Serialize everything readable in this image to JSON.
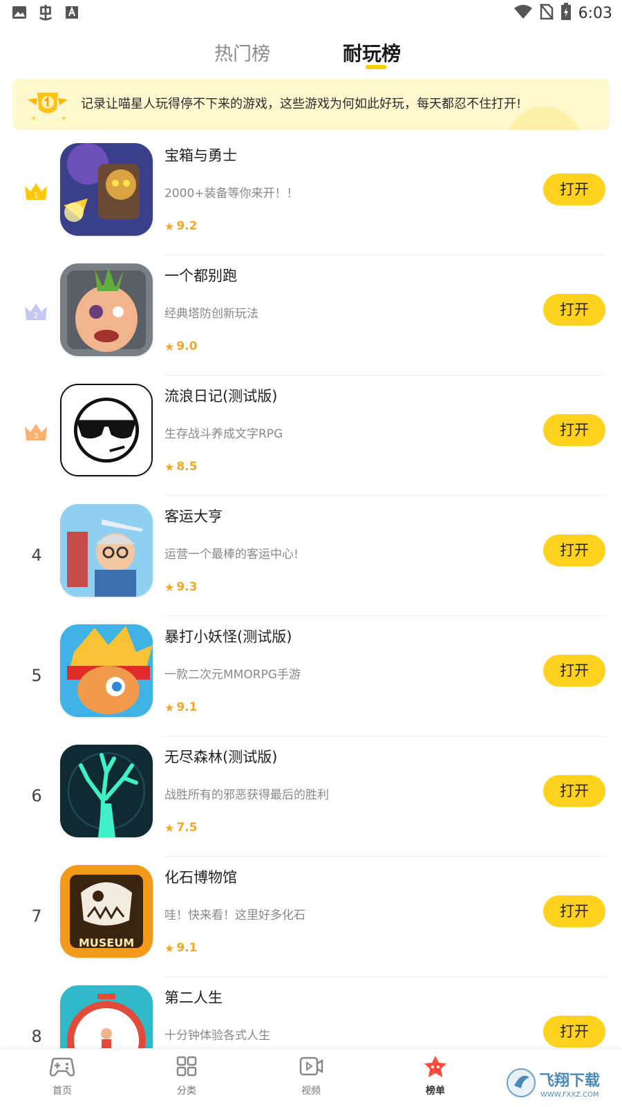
{
  "status_bar": {
    "time": "6:03"
  },
  "tabs": [
    {
      "label": "热门榜",
      "active": false
    },
    {
      "label": "耐玩榜",
      "active": true
    }
  ],
  "banner": {
    "text": "记录让喵星人玩得停不下来的游戏，这些游戏为何如此好玩，每天都忍不住打开!"
  },
  "apps": [
    {
      "rank": "1",
      "title": "宝箱与勇士",
      "desc": "2000+装备等你来开！！",
      "rating": "9.2",
      "button": "打开"
    },
    {
      "rank": "2",
      "title": "一个都别跑",
      "desc": "经典塔防创新玩法",
      "rating": "9.0",
      "button": "打开"
    },
    {
      "rank": "3",
      "title": "流浪日记(测试版)",
      "desc": "生存战斗养成文字RPG",
      "rating": "8.5",
      "button": "打开"
    },
    {
      "rank": "4",
      "title": "客运大亨",
      "desc": "运营一个最棒的客运中心!",
      "rating": "9.3",
      "button": "打开"
    },
    {
      "rank": "5",
      "title": "暴打小妖怪(测试版)",
      "desc": "一款二次元MMORPG手游",
      "rating": "9.1",
      "button": "打开"
    },
    {
      "rank": "6",
      "title": "无尽森林(测试版)",
      "desc": "战胜所有的邪恶获得最后的胜利",
      "rating": "7.5",
      "button": "打开"
    },
    {
      "rank": "7",
      "title": "化石博物馆",
      "desc": "哇！快来看！这里好多化石",
      "rating": "9.1",
      "button": "打开"
    },
    {
      "rank": "8",
      "title": "第二人生",
      "desc": "十分钟体验各式人生",
      "rating": "",
      "button": "打开"
    }
  ],
  "bottom_nav": [
    {
      "label": "首页",
      "icon": "gamepad-icon"
    },
    {
      "label": "分类",
      "icon": "grid-icon"
    },
    {
      "label": "视频",
      "icon": "video-icon"
    },
    {
      "label": "榜单",
      "icon": "star-icon",
      "active": true
    }
  ],
  "watermark": {
    "text": "飞翔下载",
    "url_text": "WWW.FXXZ.COM"
  },
  "colors": {
    "accent": "#ffd21f",
    "rating": "#f5a623",
    "banner_bg": "#fff8cf"
  }
}
